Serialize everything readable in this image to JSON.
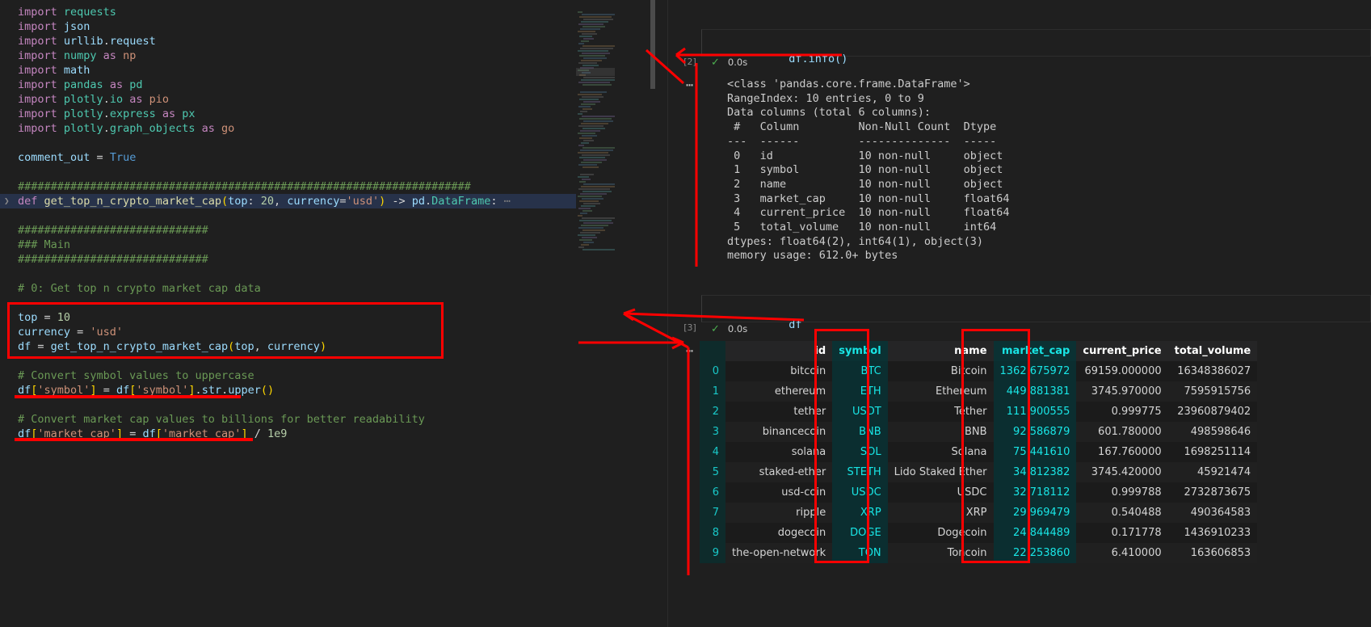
{
  "editor": {
    "lines": [
      {
        "indent": 0,
        "fold": false,
        "sel": false,
        "tokens": [
          {
            "t": "import ",
            "c": "kw"
          },
          {
            "t": "requests",
            "c": "mod"
          }
        ]
      },
      {
        "indent": 0,
        "fold": false,
        "sel": false,
        "tokens": [
          {
            "t": "import ",
            "c": "kw"
          },
          {
            "t": "json",
            "c": "mod2"
          }
        ]
      },
      {
        "indent": 0,
        "fold": false,
        "sel": false,
        "tokens": [
          {
            "t": "import ",
            "c": "kw"
          },
          {
            "t": "urllib",
            "c": "mod2"
          },
          {
            "t": ".",
            "c": "op"
          },
          {
            "t": "request",
            "c": "mod2"
          }
        ]
      },
      {
        "indent": 0,
        "fold": false,
        "sel": false,
        "tokens": [
          {
            "t": "import ",
            "c": "kw"
          },
          {
            "t": "numpy",
            "c": "mod"
          },
          {
            "t": " as ",
            "c": "as"
          },
          {
            "t": "np",
            "c": "str"
          }
        ]
      },
      {
        "indent": 0,
        "fold": false,
        "sel": false,
        "tokens": [
          {
            "t": "import ",
            "c": "kw"
          },
          {
            "t": "math",
            "c": "mod2"
          }
        ]
      },
      {
        "indent": 0,
        "fold": false,
        "sel": false,
        "tokens": [
          {
            "t": "import ",
            "c": "kw"
          },
          {
            "t": "pandas",
            "c": "mod"
          },
          {
            "t": " as ",
            "c": "as"
          },
          {
            "t": "pd",
            "c": "mod"
          }
        ]
      },
      {
        "indent": 0,
        "fold": false,
        "sel": false,
        "tokens": [
          {
            "t": "import ",
            "c": "kw"
          },
          {
            "t": "plotly",
            "c": "mod"
          },
          {
            "t": ".",
            "c": "op"
          },
          {
            "t": "io",
            "c": "mod"
          },
          {
            "t": " as ",
            "c": "as"
          },
          {
            "t": "pio",
            "c": "str"
          }
        ]
      },
      {
        "indent": 0,
        "fold": false,
        "sel": false,
        "tokens": [
          {
            "t": "import ",
            "c": "kw"
          },
          {
            "t": "plotly",
            "c": "mod"
          },
          {
            "t": ".",
            "c": "op"
          },
          {
            "t": "express",
            "c": "mod"
          },
          {
            "t": " as ",
            "c": "as"
          },
          {
            "t": "px",
            "c": "mod"
          }
        ]
      },
      {
        "indent": 0,
        "fold": false,
        "sel": false,
        "tokens": [
          {
            "t": "import ",
            "c": "kw"
          },
          {
            "t": "plotly",
            "c": "mod"
          },
          {
            "t": ".",
            "c": "op"
          },
          {
            "t": "graph_objects",
            "c": "mod"
          },
          {
            "t": " as ",
            "c": "as"
          },
          {
            "t": "go",
            "c": "str"
          }
        ]
      },
      {
        "indent": 0,
        "fold": false,
        "sel": false,
        "tokens": []
      },
      {
        "indent": 0,
        "fold": false,
        "sel": false,
        "tokens": [
          {
            "t": "comment_out ",
            "c": "var"
          },
          {
            "t": "= ",
            "c": "op"
          },
          {
            "t": "True",
            "c": "kw2"
          }
        ]
      },
      {
        "indent": 0,
        "fold": false,
        "sel": false,
        "tokens": []
      },
      {
        "indent": 0,
        "fold": false,
        "sel": false,
        "tokens": [
          {
            "t": "#####################################################################",
            "c": "cmt"
          }
        ]
      },
      {
        "indent": 0,
        "fold": true,
        "sel": true,
        "tokens": [
          {
            "t": "def ",
            "c": "kw"
          },
          {
            "t": "get_top_n_crypto_market_cap",
            "c": "fn"
          },
          {
            "t": "(",
            "c": "pl"
          },
          {
            "t": "top",
            "c": "var"
          },
          {
            "t": ": ",
            "c": "op"
          },
          {
            "t": "20",
            "c": "num"
          },
          {
            "t": ", ",
            "c": "op"
          },
          {
            "t": "currency",
            "c": "var"
          },
          {
            "t": "=",
            "c": "op"
          },
          {
            "t": "'usd'",
            "c": "str"
          },
          {
            "t": ")",
            "c": "pl"
          },
          {
            "t": " -> ",
            "c": "op"
          },
          {
            "t": "pd",
            "c": "mod2"
          },
          {
            "t": ".",
            "c": "op"
          },
          {
            "t": "DataFrame",
            "c": "cls"
          },
          {
            "t": ": ",
            "c": "op"
          },
          {
            "t": "⋯",
            "c": "fold"
          }
        ]
      },
      {
        "indent": 0,
        "fold": false,
        "sel": false,
        "tokens": []
      },
      {
        "indent": 0,
        "fold": false,
        "sel": false,
        "tokens": [
          {
            "t": "#############################",
            "c": "cmt"
          }
        ]
      },
      {
        "indent": 0,
        "fold": false,
        "sel": false,
        "tokens": [
          {
            "t": "### Main",
            "c": "cmt"
          }
        ]
      },
      {
        "indent": 0,
        "fold": false,
        "sel": false,
        "tokens": [
          {
            "t": "#############################",
            "c": "cmt"
          }
        ]
      },
      {
        "indent": 0,
        "fold": false,
        "sel": false,
        "tokens": []
      },
      {
        "indent": 0,
        "fold": false,
        "sel": false,
        "tokens": [
          {
            "t": "# 0: Get top n crypto market cap data",
            "c": "cmt"
          }
        ]
      },
      {
        "indent": 0,
        "fold": false,
        "sel": false,
        "tokens": []
      },
      {
        "indent": 0,
        "fold": false,
        "sel": false,
        "tokens": [
          {
            "t": "top ",
            "c": "var"
          },
          {
            "t": "= ",
            "c": "op"
          },
          {
            "t": "10",
            "c": "num"
          }
        ]
      },
      {
        "indent": 0,
        "fold": false,
        "sel": false,
        "tokens": [
          {
            "t": "currency ",
            "c": "var"
          },
          {
            "t": "= ",
            "c": "op"
          },
          {
            "t": "'usd'",
            "c": "str"
          }
        ]
      },
      {
        "indent": 0,
        "fold": false,
        "sel": false,
        "tokens": [
          {
            "t": "df ",
            "c": "var"
          },
          {
            "t": "= ",
            "c": "op"
          },
          {
            "t": "get_top_n_crypto_market_cap",
            "c": "var"
          },
          {
            "t": "(",
            "c": "pl"
          },
          {
            "t": "top",
            "c": "var"
          },
          {
            "t": ", ",
            "c": "op"
          },
          {
            "t": "currency",
            "c": "var"
          },
          {
            "t": ")",
            "c": "pl"
          }
        ]
      },
      {
        "indent": 0,
        "fold": false,
        "sel": false,
        "tokens": []
      },
      {
        "indent": 0,
        "fold": false,
        "sel": false,
        "tokens": [
          {
            "t": "# Convert symbol values to uppercase",
            "c": "cmt"
          }
        ]
      },
      {
        "indent": 0,
        "fold": false,
        "sel": false,
        "tokens": [
          {
            "t": "df",
            "c": "var"
          },
          {
            "t": "[",
            "c": "pl"
          },
          {
            "t": "'symbol'",
            "c": "str"
          },
          {
            "t": "]",
            "c": "pl"
          },
          {
            "t": " = ",
            "c": "op"
          },
          {
            "t": "df",
            "c": "var"
          },
          {
            "t": "[",
            "c": "pl"
          },
          {
            "t": "'symbol'",
            "c": "str"
          },
          {
            "t": "]",
            "c": "pl"
          },
          {
            "t": ".",
            "c": "op"
          },
          {
            "t": "str",
            "c": "var"
          },
          {
            "t": ".",
            "c": "op"
          },
          {
            "t": "upper",
            "c": "var"
          },
          {
            "t": "()",
            "c": "pl"
          }
        ]
      },
      {
        "indent": 0,
        "fold": false,
        "sel": false,
        "tokens": []
      },
      {
        "indent": 0,
        "fold": false,
        "sel": false,
        "tokens": [
          {
            "t": "# Convert market cap values to billions for better readability",
            "c": "cmt"
          }
        ]
      },
      {
        "indent": 0,
        "fold": false,
        "sel": false,
        "tokens": [
          {
            "t": "df",
            "c": "var"
          },
          {
            "t": "[",
            "c": "pl"
          },
          {
            "t": "'market_cap'",
            "c": "str"
          },
          {
            "t": "]",
            "c": "pl"
          },
          {
            "t": " = ",
            "c": "op"
          },
          {
            "t": "df",
            "c": "var"
          },
          {
            "t": "[",
            "c": "pl"
          },
          {
            "t": "'market_cap'",
            "c": "str"
          },
          {
            "t": "]",
            "c": "pl"
          },
          {
            "t": " / ",
            "c": "op"
          },
          {
            "t": "1e9",
            "c": "num"
          }
        ]
      }
    ]
  },
  "notebook": {
    "cell_info": {
      "exec_label": "[2]",
      "source": "df.info()",
      "status_time": "0.0s",
      "status_icon": "check-icon",
      "output": "<class 'pandas.core.frame.DataFrame'>\nRangeIndex: 10 entries, 0 to 9\nData columns (total 6 columns):\n #   Column         Non-Null Count  Dtype  \n---  ------         --------------  -----  \n 0   id             10 non-null     object \n 1   symbol         10 non-null     object \n 2   name           10 non-null     object \n 3   market_cap     10 non-null     float64\n 4   current_price  10 non-null     float64\n 5   total_volume   10 non-null     int64  \ndtypes: float64(2), int64(1), object(3)\nmemory usage: 612.0+ bytes"
    },
    "cell_df": {
      "exec_label": "[3]",
      "source": "df",
      "status_time": "0.0s",
      "status_icon": "check-icon"
    }
  },
  "dataframe": {
    "columns": [
      "",
      "id",
      "symbol",
      "name",
      "market_cap",
      "current_price",
      "total_volume"
    ],
    "highlighted_columns": [
      "symbol",
      "market_cap"
    ],
    "rows": [
      {
        "idx": "0",
        "id": "bitcoin",
        "symbol": "BTC",
        "name": "Bitcoin",
        "market_cap": "1362.675972",
        "current_price": "69159.000000",
        "total_volume": "16348386027"
      },
      {
        "idx": "1",
        "id": "ethereum",
        "symbol": "ETH",
        "name": "Ethereum",
        "market_cap": "449.881381",
        "current_price": "3745.970000",
        "total_volume": "7595915756"
      },
      {
        "idx": "2",
        "id": "tether",
        "symbol": "USDT",
        "name": "Tether",
        "market_cap": "111.900555",
        "current_price": "0.999775",
        "total_volume": "23960879402"
      },
      {
        "idx": "3",
        "id": "binancecoin",
        "symbol": "BNB",
        "name": "BNB",
        "market_cap": "92.586879",
        "current_price": "601.780000",
        "total_volume": "498598646"
      },
      {
        "idx": "4",
        "id": "solana",
        "symbol": "SOL",
        "name": "Solana",
        "market_cap": "75.441610",
        "current_price": "167.760000",
        "total_volume": "1698251114"
      },
      {
        "idx": "5",
        "id": "staked-ether",
        "symbol": "STETH",
        "name": "Lido Staked Ether",
        "market_cap": "34.812382",
        "current_price": "3745.420000",
        "total_volume": "45921474"
      },
      {
        "idx": "6",
        "id": "usd-coin",
        "symbol": "USDC",
        "name": "USDC",
        "market_cap": "32.718112",
        "current_price": "0.999788",
        "total_volume": "2732873675"
      },
      {
        "idx": "7",
        "id": "ripple",
        "symbol": "XRP",
        "name": "XRP",
        "market_cap": "29.969479",
        "current_price": "0.540488",
        "total_volume": "490364583"
      },
      {
        "idx": "8",
        "id": "dogecoin",
        "symbol": "DOGE",
        "name": "Dogecoin",
        "market_cap": "24.844489",
        "current_price": "0.171778",
        "total_volume": "1436910233"
      },
      {
        "idx": "9",
        "id": "the-open-network",
        "symbol": "TON",
        "name": "Toncoin",
        "market_cap": "22.253860",
        "current_price": "6.410000",
        "total_volume": "163606853"
      }
    ]
  },
  "annotations": {
    "accent_color": "#ff0000",
    "highlight_color": "#19e5e5",
    "boxes": [
      {
        "name": "code-block-highlight-box"
      },
      {
        "name": "symbol-column-highlight-box"
      },
      {
        "name": "market-cap-column-highlight-box"
      }
    ],
    "underlines": [
      {
        "name": "symbol-uppercase-underline"
      },
      {
        "name": "market-cap-billions-underline"
      }
    ]
  }
}
